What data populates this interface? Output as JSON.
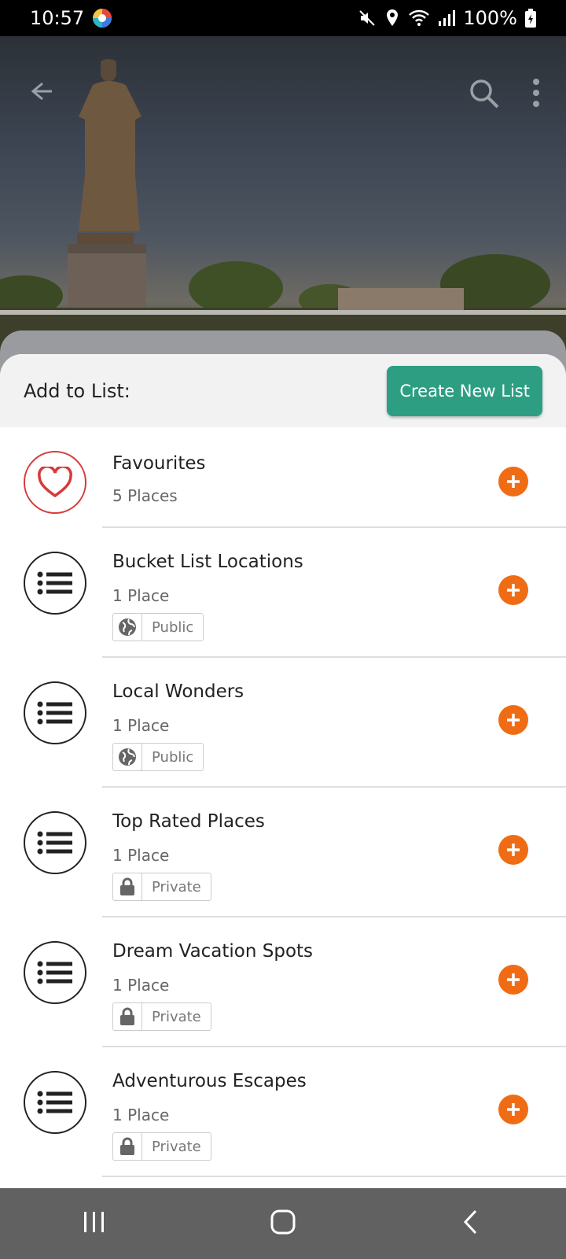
{
  "status_bar": {
    "time": "10:57",
    "battery": "100%",
    "icons": [
      "app-notification-icon",
      "mute-icon",
      "location-icon",
      "wifi-icon",
      "signal-icon",
      "battery-icon"
    ]
  },
  "toolbar": {
    "icons": [
      "back-arrow-icon",
      "search-icon",
      "more-vert-icon"
    ]
  },
  "sheet": {
    "title": "Add to List:",
    "create_button": "Create New List"
  },
  "lists": [
    {
      "name": "Favourites",
      "count": "5 Places",
      "icon": "heart-icon"
    },
    {
      "name": "Bucket List Locations",
      "count": "1 Place",
      "visibility": "Public",
      "visibility_icon": "globe-icon",
      "icon": "list-icon"
    },
    {
      "name": "Local Wonders",
      "count": "1 Place",
      "visibility": "Public",
      "visibility_icon": "globe-icon",
      "icon": "list-icon"
    },
    {
      "name": "Top Rated Places",
      "count": "1 Place",
      "visibility": "Private",
      "visibility_icon": "lock-icon",
      "icon": "list-icon"
    },
    {
      "name": "Dream Vacation Spots",
      "count": "1 Place",
      "visibility": "Private",
      "visibility_icon": "lock-icon",
      "icon": "list-icon"
    },
    {
      "name": "Adventurous Escapes",
      "count": "1 Place",
      "visibility": "Private",
      "visibility_icon": "lock-icon",
      "icon": "list-icon"
    }
  ],
  "colors": {
    "accent_green": "#2e9e82",
    "add_orange": "#f06c14",
    "favourite_red": "#d63a3a"
  },
  "nav_bar": {
    "icons": [
      "recent-apps-icon",
      "home-icon",
      "back-icon"
    ]
  }
}
